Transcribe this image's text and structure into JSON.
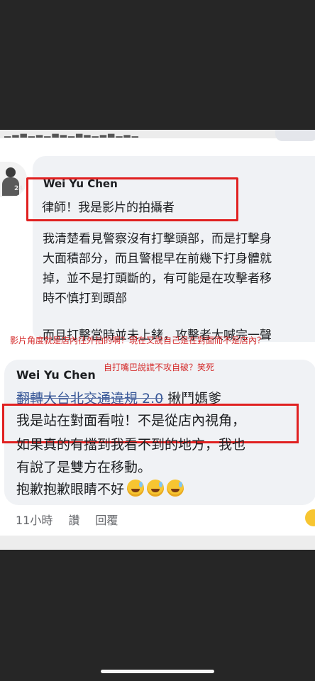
{
  "comment1": {
    "author": "Wei Yu Chen",
    "avatar_badge": "24",
    "lead": "律師！我是影片的拍攝者",
    "paragraph1": [
      "我清楚看見警察沒有打擊頭部，而是打擊身",
      "大面積部分，而且警棍早在前幾下打身體就",
      "掉，並不是打頭斷的，有可能是在攻擊者移",
      "時不慎打到頭部"
    ],
    "paragraph2": "而且打擊當時並未上銬，攻擊者大喊完一聲"
  },
  "annotations": {
    "note1": "影片角度就是店內往外拍的啊？現在又說自己是在對面而不是店內？",
    "note2": "自打嘴巴說謊不攻自破？笑死"
  },
  "comment2": {
    "author": "Wei Yu Chen",
    "tag_link": "翻轉大台北交通違規 2.0",
    "tag_rest": " 揪鬥媽爹",
    "line1": "我是站在對面看啦！不是從店內視角，",
    "line2": "如果真的有擋到我看不到的地方，我也",
    "line3": "有說了是雙方在移動。",
    "line4": "抱歉抱歉眼睛不好",
    "emoji": "sweat-smile",
    "time": "11小時",
    "like": "讚",
    "reply": "回覆"
  }
}
